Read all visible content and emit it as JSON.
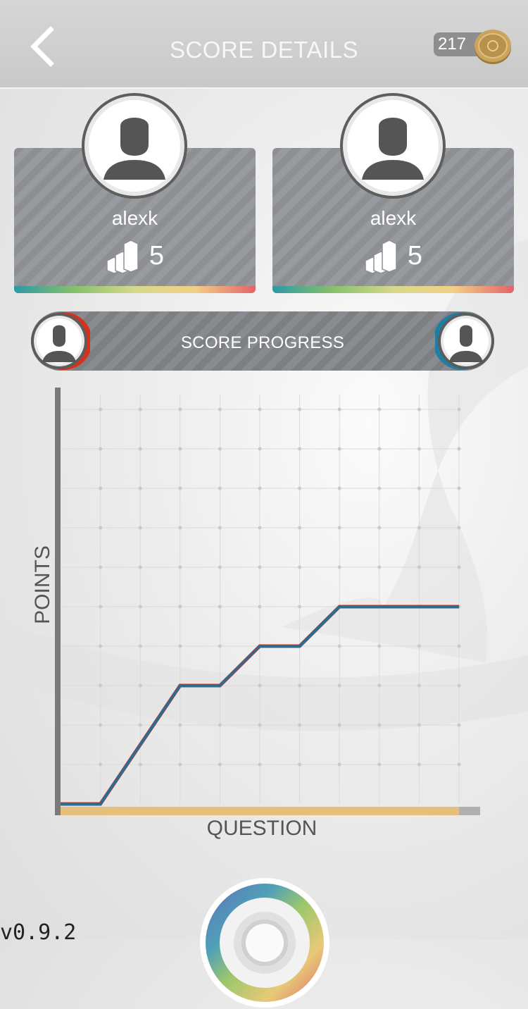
{
  "header": {
    "title": "SCORE DETAILS",
    "coins": "217"
  },
  "players": [
    {
      "name": "alexk",
      "level": "5",
      "color": "#d8311b"
    },
    {
      "name": "alexk",
      "level": "5",
      "color": "#1f7ea3"
    }
  ],
  "progress": {
    "title": "SCORE PROGRESS"
  },
  "chart_data": {
    "type": "line",
    "xlabel": "QUESTION",
    "ylabel": "POINTS",
    "x": [
      0,
      1,
      2,
      3,
      4,
      5,
      6,
      7,
      8,
      9,
      10
    ],
    "xlim": [
      0,
      10
    ],
    "ylim": [
      0,
      10
    ],
    "grid": true,
    "series": [
      {
        "values": [
          0,
          0,
          1.5,
          3,
          3,
          4,
          4,
          5,
          5,
          5,
          5
        ],
        "color": "#d8311b"
      },
      {
        "values": [
          0,
          0,
          1.5,
          3,
          3,
          4,
          4,
          5,
          5,
          5,
          5
        ],
        "color": "#2f6b8c"
      }
    ]
  },
  "footer": {
    "version": "v0.9.2"
  }
}
